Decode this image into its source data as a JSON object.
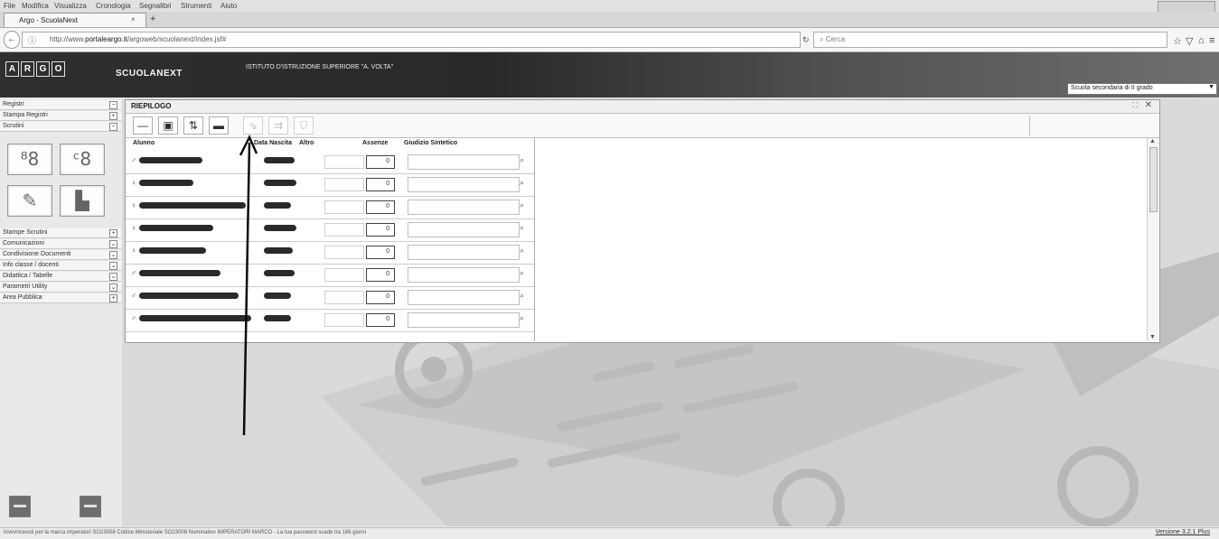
{
  "browser": {
    "menu": [
      "File",
      "Modifica",
      "Visualizza",
      "Cronologia",
      "Segnalibri",
      "Strumenti",
      "Aiuto"
    ],
    "tab_title": "Argo - ScuolaNext",
    "tab_close": "×",
    "new_tab": "+",
    "url_prefix": "http://www.",
    "url_domain": "portaleargo.it",
    "url_rest": "/argoweb/scuolanext/index.jsf#",
    "search_placeholder": "Cerca",
    "back": "←"
  },
  "app": {
    "logo_letters": [
      "A",
      "R",
      "G",
      "O"
    ],
    "brand": "SCUOLANEXT",
    "school_name": "ISTITUTO D'ISTRUZIONE SUPERIORE \"A. VOLTA\"",
    "school_select": "Scuola secondaria di II grado"
  },
  "sidebar": {
    "items_top": [
      {
        "label": "Registri",
        "icon": "minus"
      },
      {
        "label": "Stampa Registri",
        "icon": "plus"
      },
      {
        "label": "Scrutini",
        "icon": "minus"
      }
    ],
    "items_bottom": [
      {
        "label": "Stampe Scrutini",
        "icon": "plus"
      },
      {
        "label": "Comunicazioni",
        "icon": "chevron"
      },
      {
        "label": "Condivisione Documenti",
        "icon": "chevron"
      },
      {
        "label": "Info classe / docenti",
        "icon": "chevron"
      },
      {
        "label": "Didattica / Tabelle",
        "icon": "chevron"
      },
      {
        "label": "Parametri Utility",
        "icon": "chevron"
      },
      {
        "label": "Area Pubblica",
        "icon": "plus"
      }
    ]
  },
  "panel": {
    "title": "RIEPILOGO",
    "columns": [
      "Alunno",
      "Data Nascita",
      "Altro",
      "Assenze",
      "Giudizio Sintetico"
    ],
    "rows": [
      {
        "gender": "♂",
        "name_blot": 70,
        "date_blot": 34,
        "assenze": "0"
      },
      {
        "gender": "♀",
        "name_blot": 60,
        "date_blot": 36,
        "assenze": "0"
      },
      {
        "gender": "♀",
        "name_blot": 118,
        "date_blot": 30,
        "assenze": "0"
      },
      {
        "gender": "♀",
        "name_blot": 82,
        "date_blot": 36,
        "assenze": "0"
      },
      {
        "gender": "♀",
        "name_blot": 74,
        "date_blot": 32,
        "assenze": "0"
      },
      {
        "gender": "♂",
        "name_blot": 90,
        "date_blot": 34,
        "assenze": "0"
      },
      {
        "gender": "♂",
        "name_blot": 110,
        "date_blot": 30,
        "assenze": "0"
      },
      {
        "gender": "♂",
        "name_blot": 124,
        "date_blot": 30,
        "assenze": "0"
      }
    ]
  },
  "status": {
    "text": "Invio/ricevuti per la marca imperatori SO23008 Codice Ministeriale SO23008 Nominativo IMPERATORI MARCO - La tua password scade tra 186 giorni",
    "version": "Versione 3.2.1 Plus"
  }
}
